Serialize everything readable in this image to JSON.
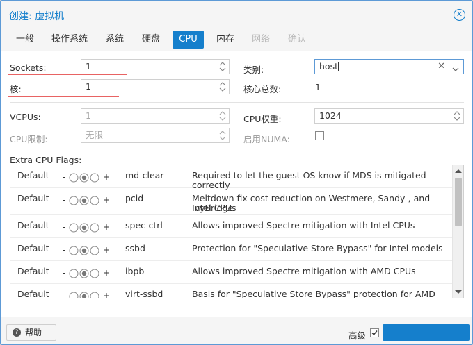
{
  "window": {
    "title": "创建: 虚拟机"
  },
  "tabs": [
    {
      "label": "一般",
      "state": "normal"
    },
    {
      "label": "操作系统",
      "state": "normal"
    },
    {
      "label": "系统",
      "state": "normal"
    },
    {
      "label": "硬盘",
      "state": "normal"
    },
    {
      "label": "CPU",
      "state": "active"
    },
    {
      "label": "内存",
      "state": "normal"
    },
    {
      "label": "网络",
      "state": "disabled"
    },
    {
      "label": "确认",
      "state": "disabled"
    }
  ],
  "form": {
    "sockets_label": "Sockets:",
    "sockets_value": "1",
    "cores_label": "核:",
    "cores_value": "1",
    "type_label": "类别:",
    "type_value": "host",
    "total_cores_label": "核心总数:",
    "total_cores_value": "1",
    "vcpus_label": "VCPUs:",
    "vcpus_value": "1",
    "cpu_weight_label": "CPU权重:",
    "cpu_weight_value": "1024",
    "cpu_limit_label": "CPU限制:",
    "cpu_limit_value": "无限",
    "numa_label": "启用NUMA:"
  },
  "flags": {
    "title": "Extra CPU Flags:",
    "minus": "-",
    "plus": "+",
    "rows": [
      {
        "state": "Default",
        "flag": "md-clear",
        "description": "Required to let the guest OS know if MDS is mitigated correctly"
      },
      {
        "state": "Default",
        "flag": "pcid",
        "description": "Meltdown fix cost reduction on Westmere, Sandy-, and IvyBridge",
        "description2": "Intel CPUs"
      },
      {
        "state": "Default",
        "flag": "spec-ctrl",
        "description": "Allows improved Spectre mitigation with Intel CPUs"
      },
      {
        "state": "Default",
        "flag": "ssbd",
        "description": "Protection for \"Speculative Store Bypass\" for Intel models"
      },
      {
        "state": "Default",
        "flag": "ibpb",
        "description": "Allows improved Spectre mitigation with AMD CPUs"
      },
      {
        "state": "Default",
        "flag": "virt-ssbd",
        "description": "Basis for \"Speculative Store Bypass\" protection for AMD models"
      }
    ]
  },
  "footer": {
    "help_label": "帮助",
    "advanced_label": "高级",
    "advanced_checked": true
  },
  "colors": {
    "accent": "#157fcc",
    "underline": "#e86363"
  }
}
